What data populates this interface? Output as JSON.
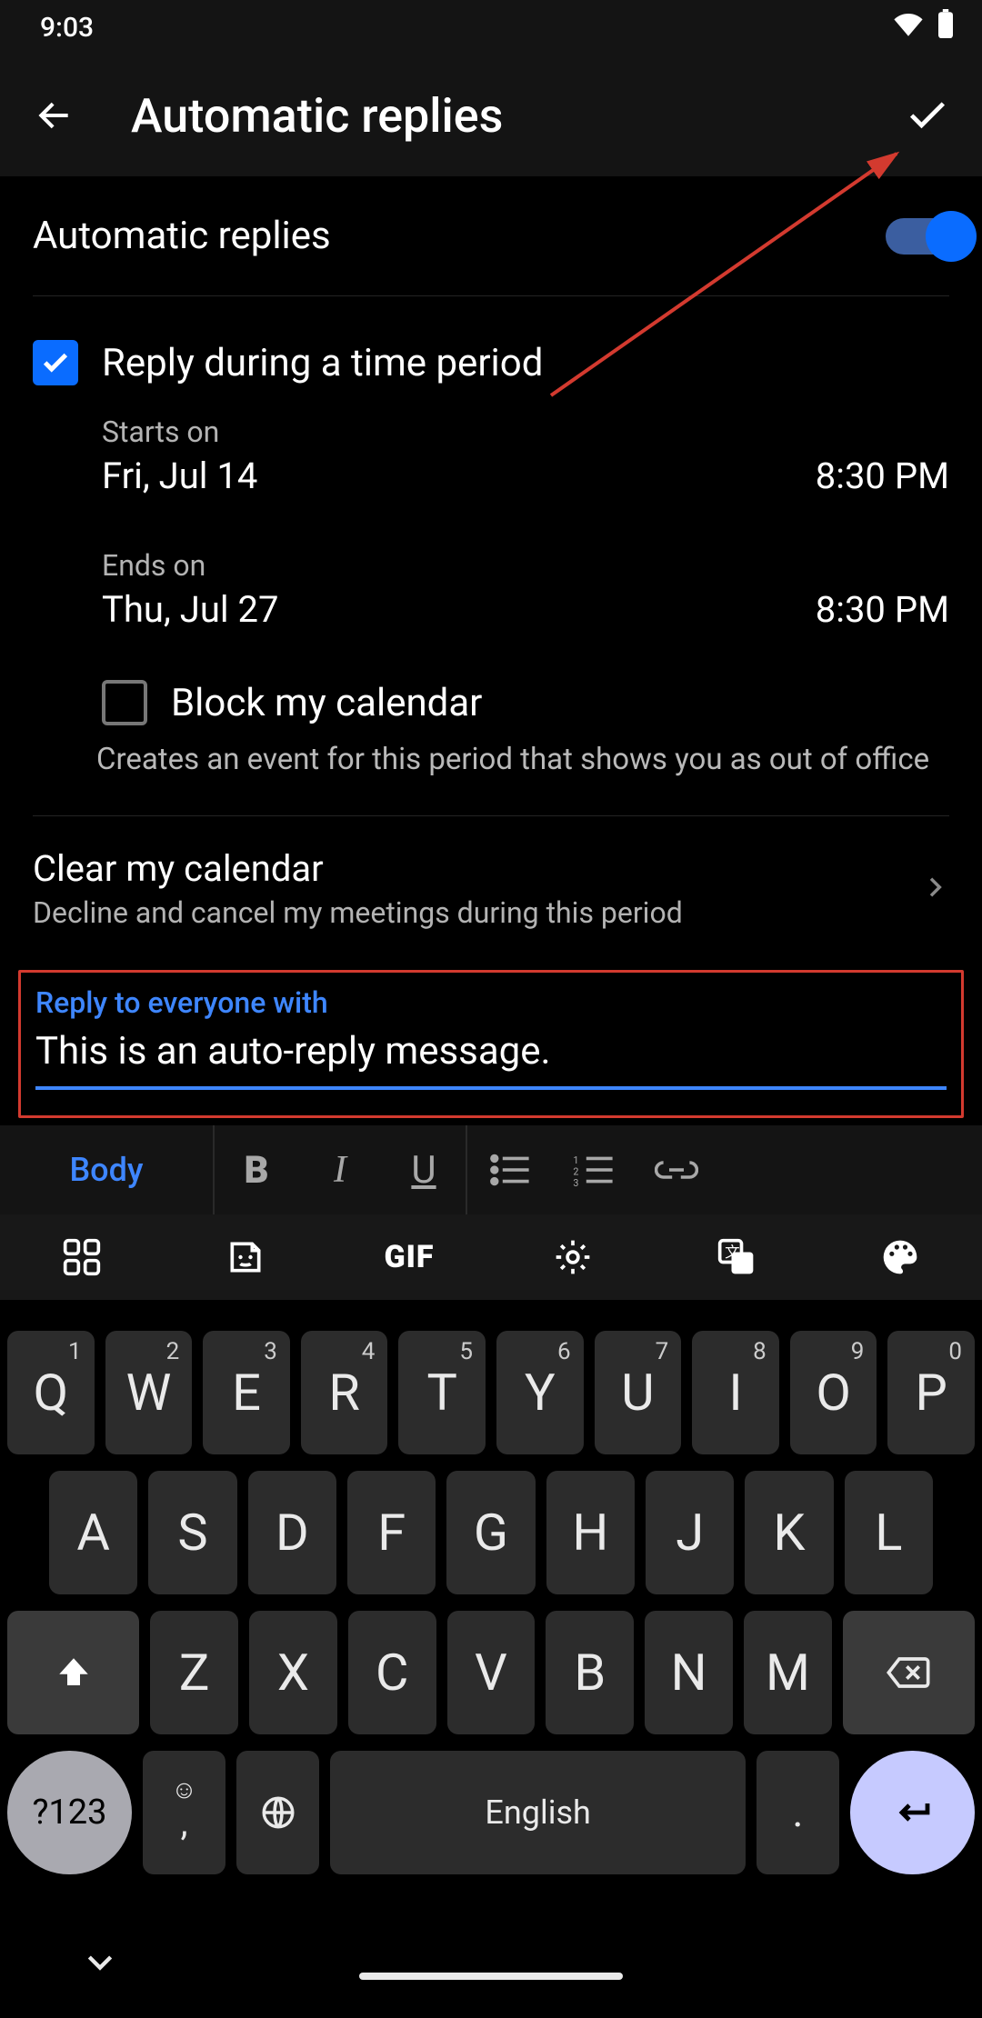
{
  "status": {
    "time": "9:03"
  },
  "header": {
    "title": "Automatic replies"
  },
  "toggle": {
    "label": "Automatic replies",
    "on": true
  },
  "time_period": {
    "checked": true,
    "label": "Reply during a time period",
    "starts_label": "Starts on",
    "starts_date": "Fri, Jul 14",
    "starts_time": "8:30 PM",
    "ends_label": "Ends on",
    "ends_date": "Thu, Jul 27",
    "ends_time": "8:30 PM"
  },
  "block_calendar": {
    "checked": false,
    "label": "Block my calendar",
    "hint": "Creates an event for this period that shows you as out of office"
  },
  "clear_calendar": {
    "title": "Clear my calendar",
    "subtitle": "Decline and cancel my meetings during this period"
  },
  "reply": {
    "label": "Reply to everyone with",
    "value": "This is an auto-reply message."
  },
  "fmt": {
    "body": "Body"
  },
  "keyboard": {
    "row1": [
      {
        "main": "Q",
        "sup": "1"
      },
      {
        "main": "W",
        "sup": "2"
      },
      {
        "main": "E",
        "sup": "3"
      },
      {
        "main": "R",
        "sup": "4"
      },
      {
        "main": "T",
        "sup": "5"
      },
      {
        "main": "Y",
        "sup": "6"
      },
      {
        "main": "U",
        "sup": "7"
      },
      {
        "main": "I",
        "sup": "8"
      },
      {
        "main": "O",
        "sup": "9"
      },
      {
        "main": "P",
        "sup": "0"
      }
    ],
    "row2": [
      "A",
      "S",
      "D",
      "F",
      "G",
      "H",
      "J",
      "K",
      "L"
    ],
    "row3": [
      "Z",
      "X",
      "C",
      "V",
      "B",
      "N",
      "M"
    ],
    "sym": "?123",
    "lang": "English",
    "period": "."
  },
  "annotation": {
    "color": "#d33a2f"
  }
}
